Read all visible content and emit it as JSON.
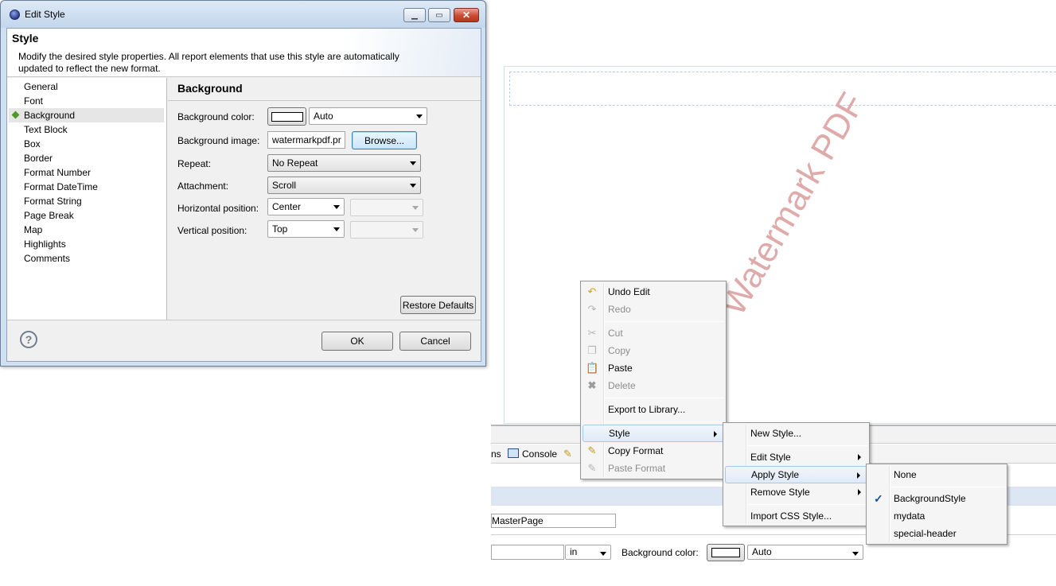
{
  "dialog": {
    "window_title": "Edit Style",
    "title": "Style",
    "description": "Modify the desired style properties. All report elements that use this style are automatically\nupdated to reflect the new format.",
    "nav": [
      "General",
      "Font",
      "Background",
      "Text Block",
      "Box",
      "Border",
      "Format Number",
      "Format DateTime",
      "Format String",
      "Page Break",
      "Map",
      "Highlights",
      "Comments"
    ],
    "nav_selected": "Background",
    "section_title": "Background",
    "fields": {
      "background_color_label": "Background color:",
      "background_color_value": "Auto",
      "background_image_label": "Background image:",
      "background_image_value": "watermarkpdf.pr",
      "browse_label": "Browse...",
      "repeat_label": "Repeat:",
      "repeat_value": "No Repeat",
      "attachment_label": "Attachment:",
      "attachment_value": "Scroll",
      "hpos_label": "Horizontal position:",
      "hpos_value": "Center",
      "vpos_label": "Vertical position:",
      "vpos_value": "Top"
    },
    "restore_defaults_label": "Restore Defaults",
    "ok_label": "OK",
    "cancel_label": "Cancel",
    "help_symbol": "?"
  },
  "editor": {
    "watermark_text": "Watermark PDF",
    "tab_partial": "ns",
    "tab_console": "Console",
    "masterpage_value": "MasterPage",
    "unit_value": "in",
    "background_color_label": "Background color:",
    "background_color_value": "Auto"
  },
  "context_menu": {
    "items": {
      "undo": "Undo Edit",
      "redo": "Redo",
      "cut": "Cut",
      "copy": "Copy",
      "paste": "Paste",
      "delete": "Delete",
      "export": "Export to Library...",
      "style": "Style",
      "copy_format": "Copy Format",
      "paste_format": "Paste Format"
    }
  },
  "style_menu": {
    "new_style": "New Style...",
    "edit_style": "Edit Style",
    "apply_style": "Apply Style",
    "remove_style": "Remove Style",
    "import_css": "Import CSS Style..."
  },
  "apply_menu": {
    "none": "None",
    "styles": [
      "BackgroundStyle",
      "mydata",
      "special-header"
    ],
    "checked": "BackgroundStyle"
  }
}
